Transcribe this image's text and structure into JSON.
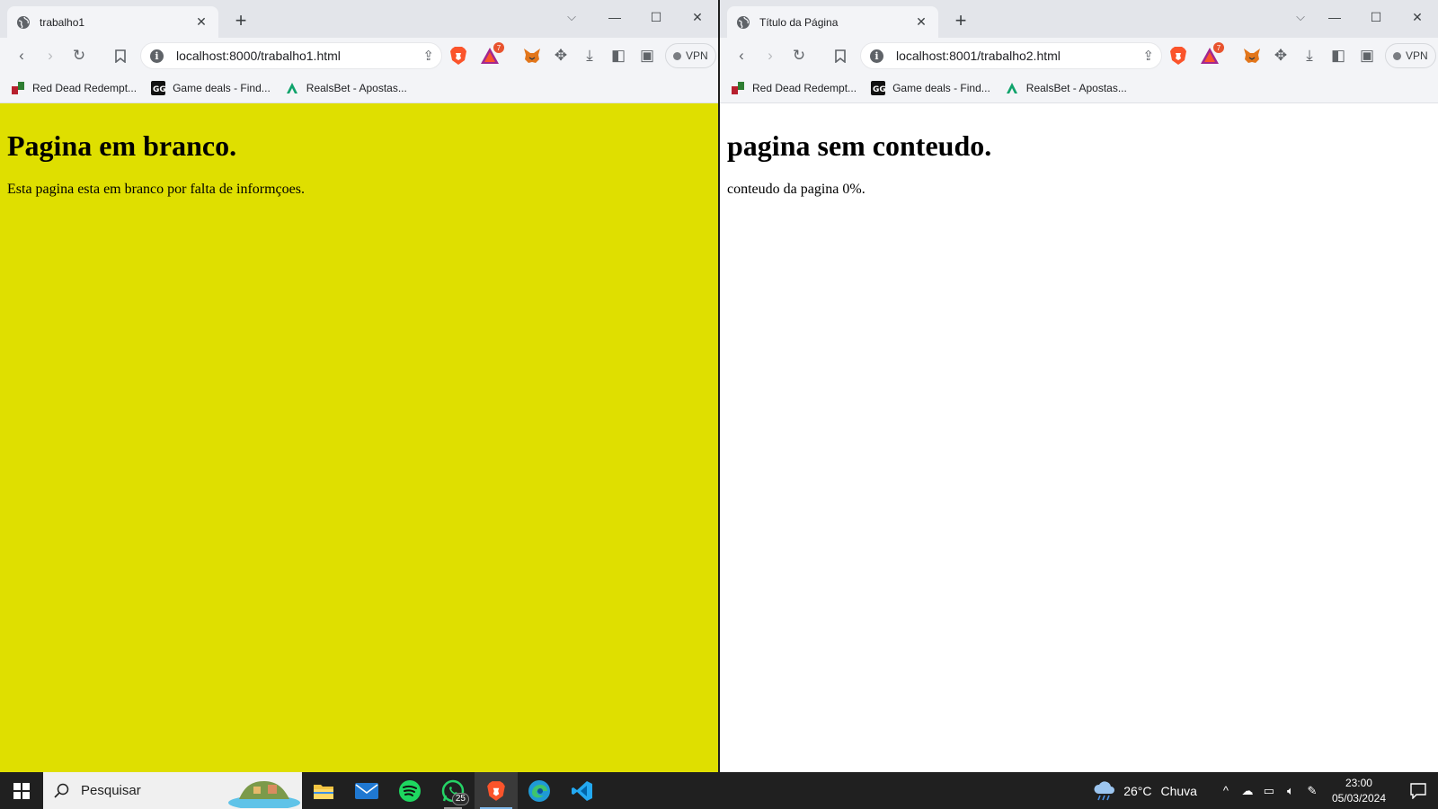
{
  "windows": [
    {
      "tab_title": "trabalho1",
      "url": "localhost:8000/trabalho1.html",
      "page_background": "#dfdf00",
      "heading": "Pagina em branco.",
      "paragraph": "Esta pagina esta em branco por falta de informçoes."
    },
    {
      "tab_title": "Título da Página",
      "url": "localhost:8001/trabalho2.html",
      "page_background": "#ffffff",
      "heading": "pagina sem conteudo.",
      "paragraph": "conteudo da pagina 0%."
    }
  ],
  "browser": {
    "rewards_badge": "7",
    "vpn_label": "VPN",
    "bookmarks": [
      {
        "label": "Red Dead Redempt...",
        "icon": "rdr-icon"
      },
      {
        "label": "Game deals - Find...",
        "icon": "gg-icon"
      },
      {
        "label": "RealsBet - Apostas...",
        "icon": "realsbet-icon"
      }
    ],
    "accent_brave": "#fb542b"
  },
  "taskbar": {
    "search_placeholder": "Pesquisar",
    "whatsapp_badge": "25",
    "weather_temp": "26°C",
    "weather_desc": "Chuva",
    "time": "23:00",
    "date": "05/03/2024"
  }
}
